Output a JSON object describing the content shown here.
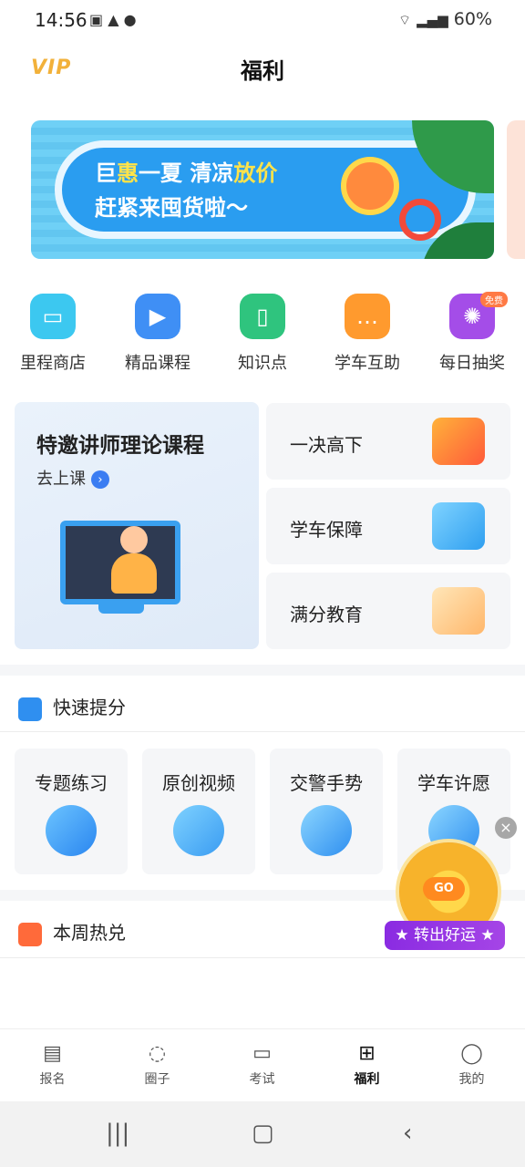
{
  "status_bar": {
    "time": "14:56",
    "battery": "60%"
  },
  "header": {
    "title": "福利",
    "vip": "VIP"
  },
  "banner": {
    "line1_a": "巨",
    "line1_b": "惠",
    "line1_c": "一夏  清凉",
    "line1_d": "放价",
    "line2": "赶紧来囤货啦～"
  },
  "quick_actions": [
    {
      "label": "里程商店",
      "icon": "shopping-bag-icon",
      "color": "#3cc8f0"
    },
    {
      "label": "精品课程",
      "icon": "video-play-icon",
      "color": "#3f8ff5"
    },
    {
      "label": "知识点",
      "icon": "open-book-icon",
      "color": "#2fc47e"
    },
    {
      "label": "学车互助",
      "icon": "chat-bubble-icon",
      "color": "#ff9a2e"
    },
    {
      "label": "每日抽奖",
      "icon": "prize-wheel-icon",
      "color": "#a44de8",
      "tag": "免费"
    }
  ],
  "promo": {
    "big_title": "特邀讲师理论课程",
    "big_sub": "去上课",
    "cards": [
      {
        "label": "一决高下"
      },
      {
        "label": "学车保障"
      },
      {
        "label": "满分教育"
      }
    ]
  },
  "quick_improve": {
    "title": "快速提分",
    "tiles": [
      {
        "label": "专题练习"
      },
      {
        "label": "原创视频"
      },
      {
        "label": "交警手势"
      },
      {
        "label": "学车许愿"
      }
    ]
  },
  "weekly": {
    "title": "本周热兑"
  },
  "lottery_float": {
    "go": "GO",
    "button": "★ 转出好运 ★",
    "close": "×"
  },
  "tabbar": [
    {
      "label": "报名",
      "icon": "document-icon"
    },
    {
      "label": "圈子",
      "icon": "chat-dots-icon"
    },
    {
      "label": "考试",
      "icon": "wallet-icon"
    },
    {
      "label": "福利",
      "icon": "gift-icon",
      "active": true
    },
    {
      "label": "我的",
      "icon": "profile-icon"
    }
  ]
}
